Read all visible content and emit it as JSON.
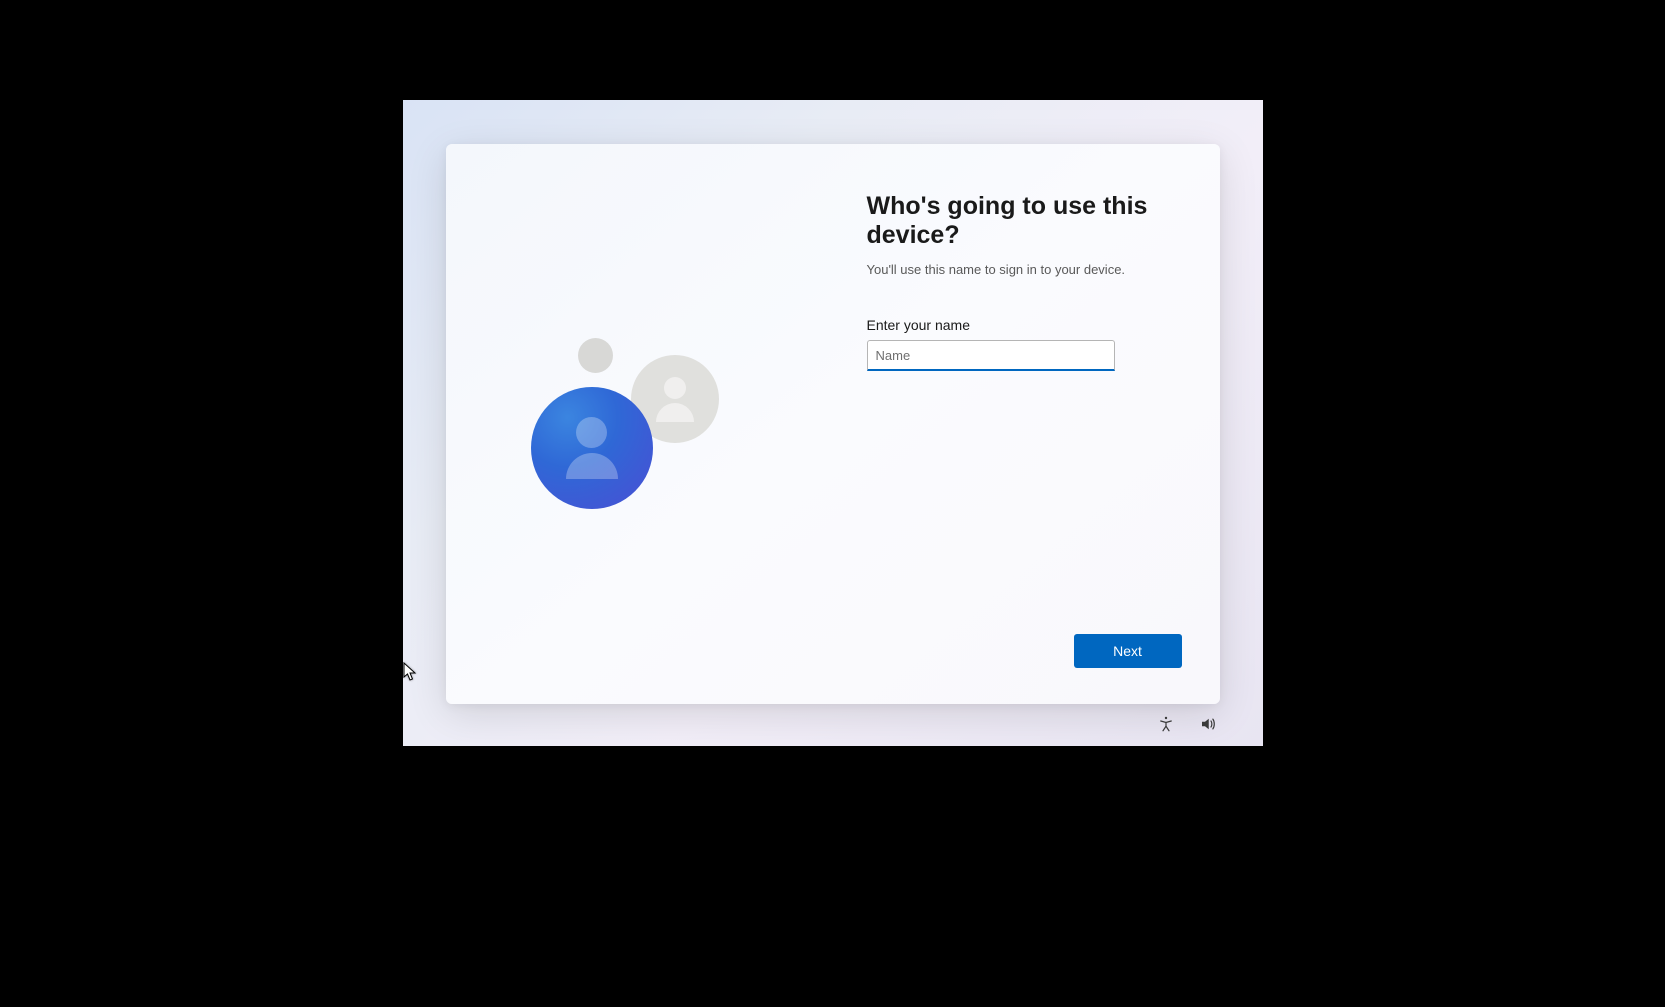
{
  "heading": "Who's going to use this device?",
  "subheading": "You'll use this name to sign in to your device.",
  "form": {
    "name_label": "Enter your name",
    "name_placeholder": "Name",
    "name_value": ""
  },
  "buttons": {
    "next": "Next"
  },
  "icons": {
    "accessibility": "accessibility",
    "volume": "volume"
  }
}
